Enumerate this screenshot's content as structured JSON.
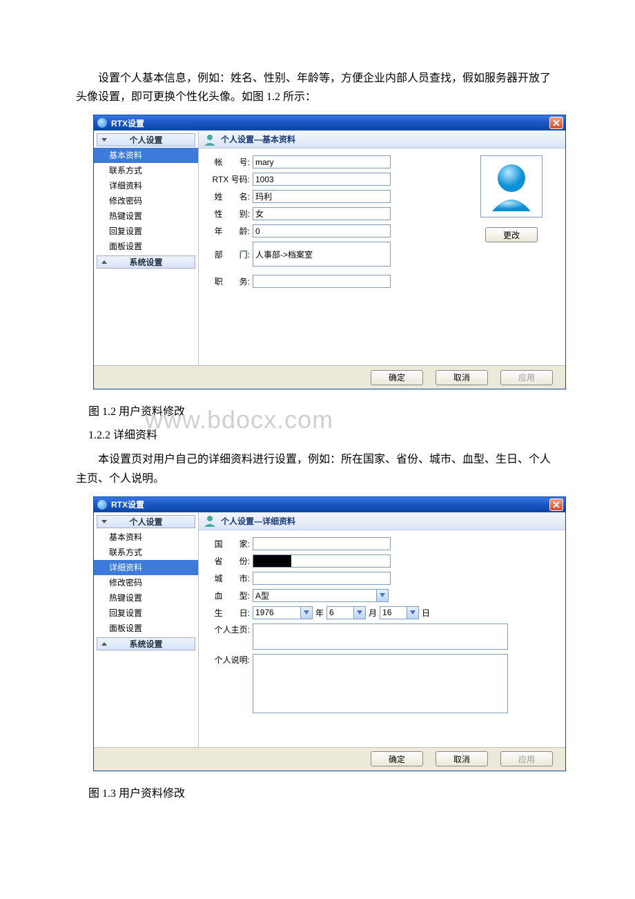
{
  "doc": {
    "para1": "设置个人基本信息，例如：姓名、性别、年龄等，方便企业内部人员查找，假如服务器开放了头像设置，即可更换个性化头像。如图 1.2 所示：",
    "caption1": "图 1.2 用户资料修改",
    "subsec": "1.2.2 详细资料",
    "para2": "本设置页对用户自己的详细资料进行设置，例如：所在国家、省份、城市、血型、生日、个人主页、个人说明。",
    "caption2": "图 1.3 用户资料修改",
    "watermark": "www.bdocx.com"
  },
  "dlg": {
    "title": "RTX设置",
    "side": {
      "hdr1": "个人设置",
      "items": [
        "基本资料",
        "联系方式",
        "详细资料",
        "修改密码",
        "热键设置",
        "回复设置",
        "面板设置"
      ],
      "hdr2": "系统设置"
    },
    "footer": {
      "ok": "确定",
      "cancel": "取消",
      "apply": "应用"
    }
  },
  "panel1": {
    "hdr": "个人设置—基本资料",
    "labels": {
      "account": "帐　　号",
      "rtx": "RTX 号码",
      "name": "姓　　名",
      "gender": "性　　别",
      "age": "年　　龄",
      "dept": "部　　门",
      "job": "职　　务"
    },
    "values": {
      "account": "mary",
      "rtx": "1003",
      "name": "玛利",
      "gender": "女",
      "age": "0",
      "dept": "人事部->档案室",
      "job": ""
    },
    "change": "更改"
  },
  "panel2": {
    "hdr": "个人设置—详细资料",
    "labels": {
      "country": "国　　家",
      "province": "省　　份",
      "city": "城　　市",
      "blood": "血　　型",
      "birth": "生　　日",
      "home": "个人主页",
      "desc": "个人说明"
    },
    "values": {
      "country": "",
      "province": "",
      "city": "",
      "blood": "A型",
      "year": "1976",
      "month": "6",
      "day": "16",
      "home": "",
      "desc": ""
    },
    "units": {
      "year": "年",
      "month": "月",
      "day": "日"
    }
  }
}
